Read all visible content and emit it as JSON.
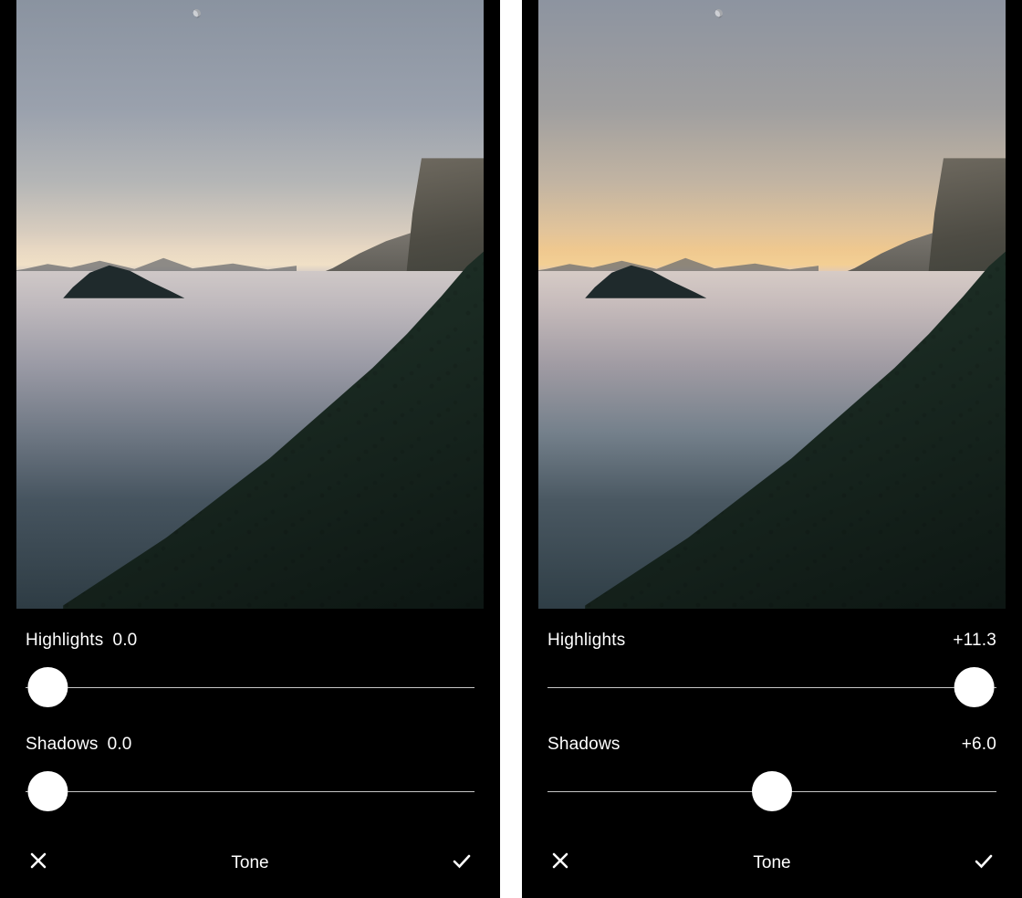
{
  "screens": {
    "left": {
      "highlights": {
        "label": "Highlights",
        "value": "0.0",
        "pos_pct": 4
      },
      "shadows": {
        "label": "Shadows",
        "value": "0.0",
        "pos_pct": 4
      },
      "section_label": "Tone"
    },
    "right": {
      "highlights": {
        "label": "Highlights",
        "value": "+11.3",
        "pos_pct": 96
      },
      "shadows": {
        "label": "Shadows",
        "value": "+6.0",
        "pos_pct": 50
      },
      "section_label": "Tone"
    }
  }
}
